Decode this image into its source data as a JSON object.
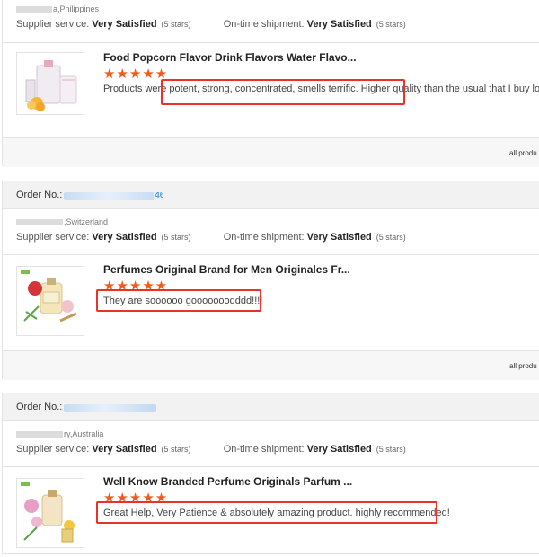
{
  "orders": [
    {
      "order_no_label": "",
      "order_no_tail": "",
      "buyer_location": "a,Philippines",
      "supplier_service_label": "Supplier service:",
      "supplier_service_value": "Very Satisfied",
      "supplier_service_stars": "(5 stars)",
      "shipment_label": "On-time shipment:",
      "shipment_value": "Very Satisfied",
      "shipment_stars": "(5 stars)",
      "product_title": "Food Popcorn Flavor Drink Flavors Water Flavo...",
      "stars": "★★★★★",
      "review": "Products were potent, strong, concentrated, smells terrific. Higher quality than the usual that I buy locally",
      "footer_text": "all produ"
    },
    {
      "order_no_label": "Order No.:",
      "order_no_tail": "46",
      "buyer_location": ",Switzerland",
      "supplier_service_label": "Supplier service:",
      "supplier_service_value": "Very Satisfied",
      "supplier_service_stars": "(5 stars)",
      "shipment_label": "On-time shipment:",
      "shipment_value": "Very Satisfied",
      "shipment_stars": "(5 stars)",
      "product_title": "Perfumes Original Brand for Men Originales Fr...",
      "stars": "★★★★★",
      "review": "They are soooooo gooooooodddd!!!!",
      "footer_text": "all produ"
    },
    {
      "order_no_label": "Order No.:",
      "order_no_tail": "",
      "buyer_location": "ry,Australia",
      "supplier_service_label": "Supplier service:",
      "supplier_service_value": "Very Satisfied",
      "supplier_service_stars": "(5 stars)",
      "shipment_label": "On-time shipment:",
      "shipment_value": "Very Satisfied",
      "shipment_stars": "(5 stars)",
      "product_title": "Well Know Branded Perfume Originals Parfum ...",
      "stars": "★★★★★",
      "review": "Great Help, Very Patience & absolutely amazing product. highly recommended!",
      "footer_text": ""
    }
  ],
  "colors": {
    "star": "#f05a1a",
    "highlight": "#e8322a",
    "order_no_link": "#2b7bd6"
  }
}
